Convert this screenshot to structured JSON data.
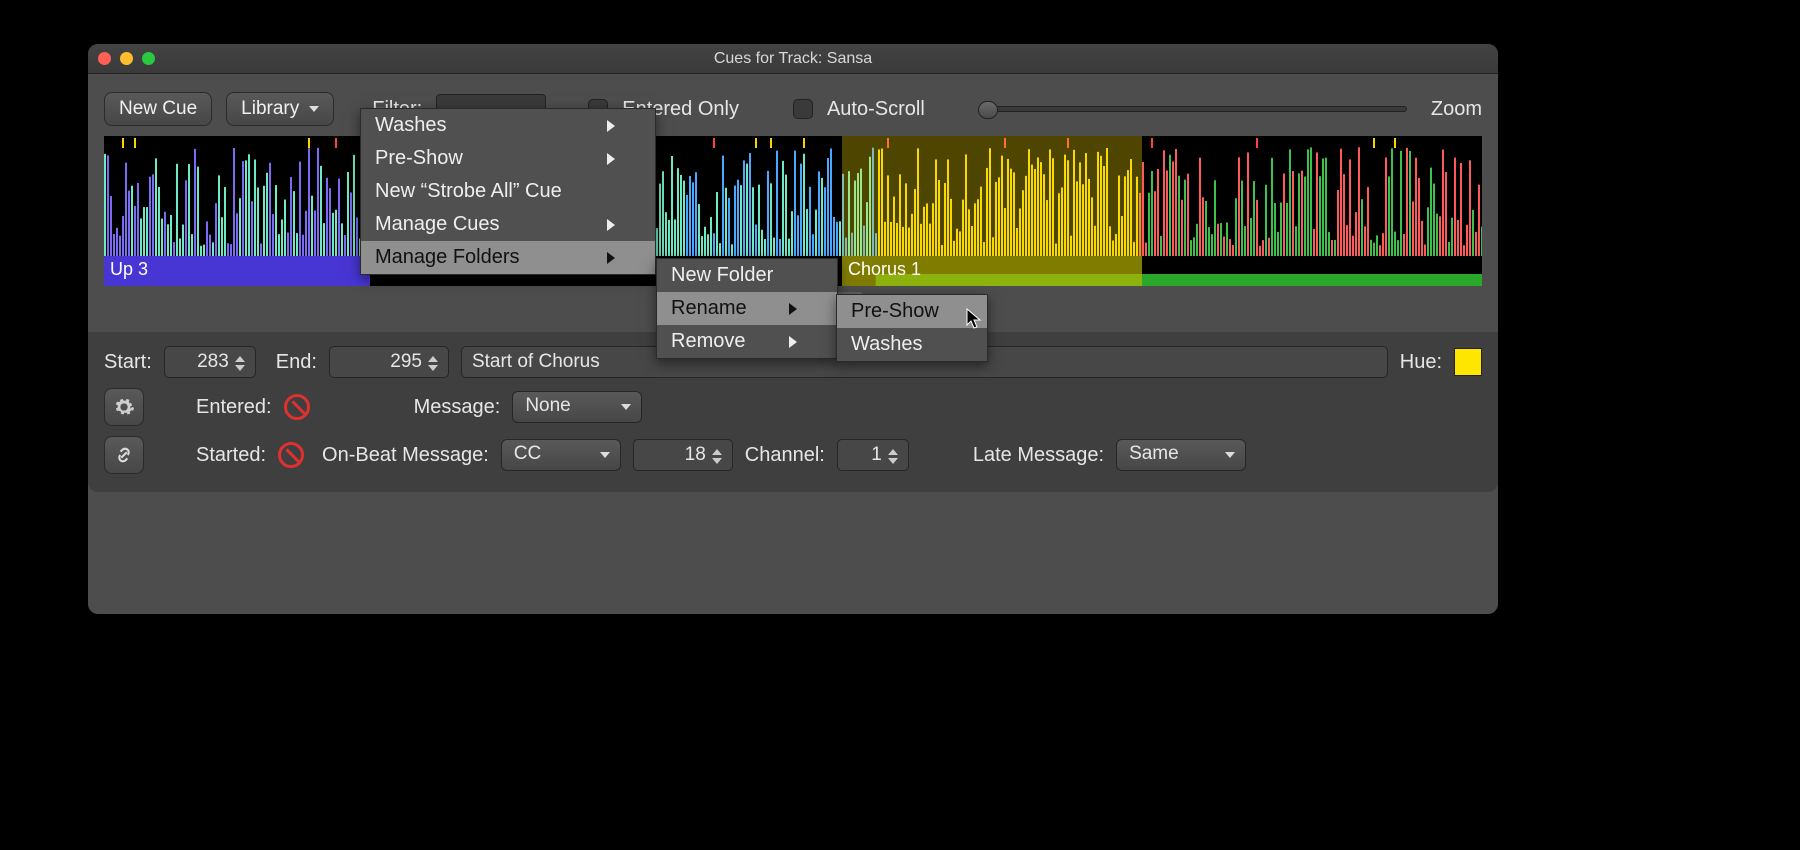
{
  "window_title": "Cues for Track: Sansa",
  "toolbar": {
    "new_cue": "New Cue",
    "library": "Library",
    "filter_label": "Filter:",
    "entered_only": "Entered Only",
    "auto_scroll": "Auto-Scroll",
    "zoom": "Zoom"
  },
  "cues": {
    "up3": "Up 3",
    "chorus1": "Chorus 1"
  },
  "menus": {
    "library": {
      "items": [
        "Washes",
        "Pre-Show",
        "New “Strobe All” Cue",
        "Manage Cues",
        "Manage Folders"
      ]
    },
    "manage_folders": {
      "items": [
        "New Folder",
        "Rename",
        "Remove"
      ]
    },
    "rename": {
      "items": [
        "Pre-Show",
        "Washes"
      ]
    }
  },
  "editor": {
    "start_label": "Start:",
    "start_value": "283",
    "end_label": "End:",
    "end_value": "295",
    "name": "Start of Chorus",
    "hue_label": "Hue:",
    "entered_label": "Entered:",
    "message_label": "Message:",
    "message_value": "None",
    "started_label": "Started:",
    "onbeat_label": "On-Beat Message:",
    "onbeat_value": "CC",
    "onbeat_num": "18",
    "channel_label": "Channel:",
    "channel_value": "1",
    "late_label": "Late Message:",
    "late_value": "Same"
  }
}
